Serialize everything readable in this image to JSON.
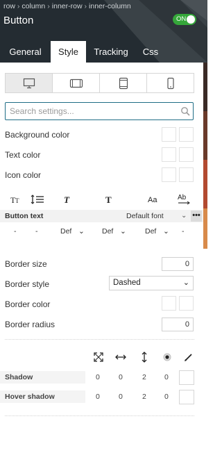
{
  "header": {
    "breadcrumb": [
      "row",
      "column",
      "inner-row",
      "inner-column"
    ],
    "breadcrumb_separator": "›",
    "title": "Button",
    "toggle_label": "ON",
    "toggle_color": "#35a73a",
    "background_color": "#242c32"
  },
  "tabs": [
    {
      "label": "General",
      "active": false
    },
    {
      "label": "Style",
      "active": true
    },
    {
      "label": "Tracking",
      "active": false
    },
    {
      "label": "Css",
      "active": false
    }
  ],
  "devices": [
    {
      "icon": "desktop-icon",
      "active": true
    },
    {
      "icon": "tablet-landscape-icon",
      "active": false
    },
    {
      "icon": "tablet-portrait-icon",
      "active": false
    },
    {
      "icon": "mobile-icon",
      "active": false
    }
  ],
  "search": {
    "placeholder": "Search settings..."
  },
  "colors": {
    "background_label": "Background color",
    "text_label": "Text color",
    "icon_label": "Icon color"
  },
  "typography": {
    "icons": [
      "font-size-icon",
      "line-height-icon",
      "italic-icon",
      "bold-icon",
      "text-transform-icon",
      "letter-spacing-icon"
    ],
    "row_label": "Button text",
    "font_value": "Default font",
    "more": "•••",
    "values": [
      "-",
      "-",
      "Def",
      "Def",
      "Def",
      "-"
    ]
  },
  "border": {
    "size_label": "Border size",
    "size_value": "0",
    "style_label": "Border style",
    "style_value": "Dashed",
    "color_label": "Border color",
    "radius_label": "Border radius",
    "radius_value": "0"
  },
  "shadows": {
    "header_icons": [
      "expand-icon",
      "horizontal-arrows-icon",
      "vertical-arrows-icon",
      "radio-dot-icon",
      "pencil-icon"
    ],
    "rows": [
      {
        "label": "Shadow",
        "values": [
          "0",
          "0",
          "2",
          "0"
        ]
      },
      {
        "label": "Hover shadow",
        "values": [
          "0",
          "0",
          "2",
          "0"
        ]
      }
    ]
  }
}
